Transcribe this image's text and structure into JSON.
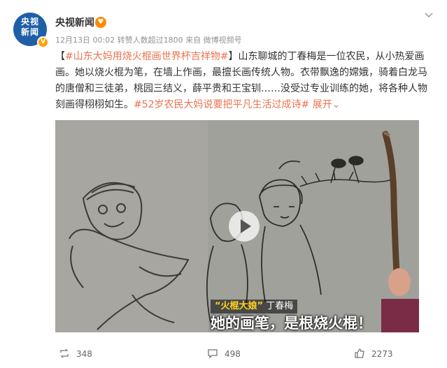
{
  "post": {
    "author": "央视新闻",
    "avatar_text_line1": "央视",
    "avatar_text_line2": "新闻",
    "badge": "♥",
    "meta": "12月13日 00:02 转赞人数超过1800  来自 微博视频号",
    "text_open_bracket": "【",
    "topic_link": "#山东大妈用烧火棍画世界杯吉祥物#",
    "text_close_bracket": "】",
    "body": "山东聊城的丁春梅是一位农民，从小热爱画画。她以烧火棍为笔，在墙上作画，最擅长画传统人物。衣带飘逸的嫦娥，骑着白龙马的唐僧和三徒弟，桃园三结义，薛平贵和王宝钏……没受过专业训练的她，将各种人物刻画得栩栩如生。",
    "topic_link_2": "#52岁农民大妈说要把平凡生活过成诗#",
    "expand_label": "展开",
    "expand_caret": "⌄"
  },
  "video": {
    "caption_name_tag": "“火棍大娘”",
    "caption_name": "丁春梅",
    "caption_main": "她的画笔，是根烧火棍！"
  },
  "actions": {
    "repost_count": "348",
    "comment_count": "498",
    "like_count": "2273"
  },
  "colors": {
    "link": "#eb7350",
    "brand": "#1f5fa8",
    "verify": "#ffa200"
  }
}
